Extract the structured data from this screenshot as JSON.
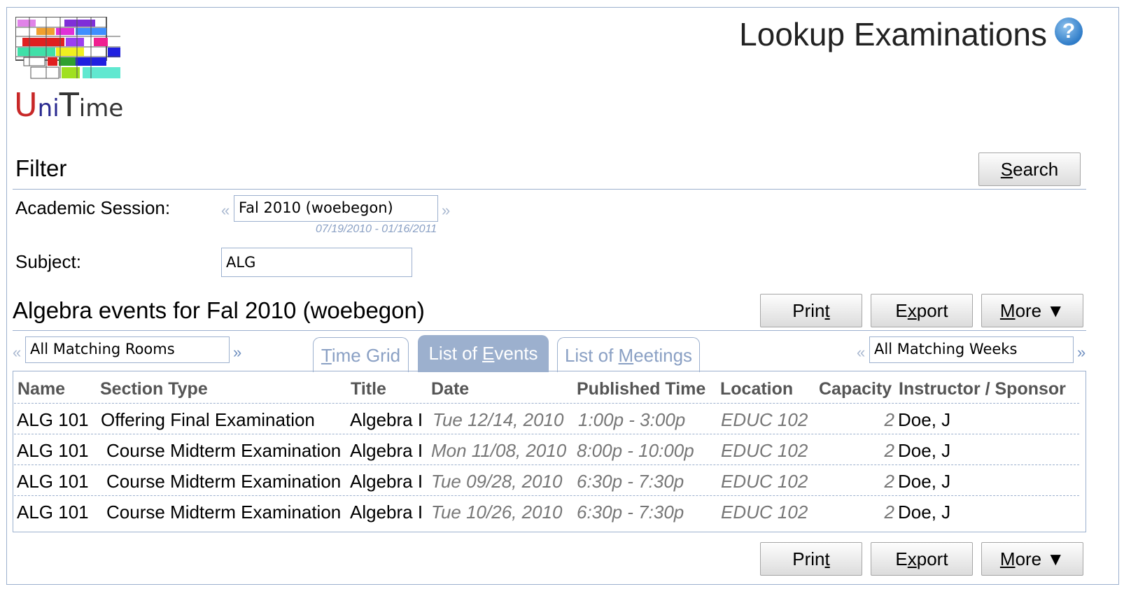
{
  "header": {
    "logo_text": "UniTime",
    "page_title": "Lookup Examinations",
    "help_label": "?"
  },
  "filter": {
    "heading": "Filter",
    "search_label": "Search",
    "session_label": "Academic Session:",
    "session_value": "Fal 2010 (woebegon)",
    "session_dates": "07/19/2010 - 01/16/2011",
    "subject_label": "Subject:",
    "subject_value": "ALG"
  },
  "results": {
    "heading": "Algebra events for Fal 2010 (woebegon)",
    "print_label": "Print",
    "export_label": "Export",
    "more_label": "More ▼",
    "rooms_filter": "All Matching Rooms",
    "weeks_filter": "All Matching Weeks",
    "prev_arrow": "«",
    "next_arrow": "»",
    "tabs": [
      {
        "label": "Time Grid",
        "active": false
      },
      {
        "label": "List of Events",
        "active": true
      },
      {
        "label": "List of Meetings",
        "active": false
      }
    ],
    "columns": [
      "Name",
      "Section Type",
      "Title",
      "Date",
      "Published Time",
      "Location",
      "Capacity",
      "Instructor / Sponsor"
    ],
    "rows": [
      {
        "name": "ALG 101",
        "section_type": "Offering Final Examination",
        "title": "Algebra I",
        "date": "Tue 12/14, 2010",
        "time": "1:00p - 3:00p",
        "location": "EDUC 102",
        "capacity": "2",
        "instructor": "Doe, J"
      },
      {
        "name": "ALG 101",
        "section_type": "Course Midterm Examination",
        "title": "Algebra I",
        "date": "Mon 11/08, 2010",
        "time": "8:00p - 10:00p",
        "location": "EDUC 102",
        "capacity": "2",
        "instructor": "Doe, J"
      },
      {
        "name": "ALG 101",
        "section_type": "Course Midterm Examination",
        "title": "Algebra I",
        "date": "Tue 09/28, 2010",
        "time": "6:30p - 7:30p",
        "location": "EDUC 102",
        "capacity": "2",
        "instructor": "Doe, J"
      },
      {
        "name": "ALG 101",
        "section_type": "Course Midterm Examination",
        "title": "Algebra I",
        "date": "Tue 10/26, 2010",
        "time": "6:30p - 7:30p",
        "location": "EDUC 102",
        "capacity": "2",
        "instructor": "Doe, J"
      }
    ]
  }
}
